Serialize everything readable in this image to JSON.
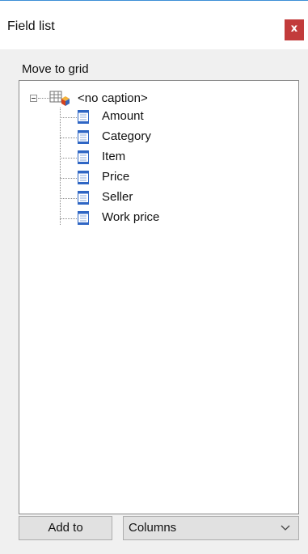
{
  "window": {
    "title": "Field list",
    "close_label": "x"
  },
  "group": {
    "label": "Move to grid"
  },
  "tree": {
    "root": {
      "label": "<no caption>",
      "icon": "cube-icon"
    },
    "items": [
      {
        "label": "Amount",
        "icon": "field-icon"
      },
      {
        "label": "Category",
        "icon": "field-icon"
      },
      {
        "label": "Item",
        "icon": "field-icon"
      },
      {
        "label": "Price",
        "icon": "field-icon"
      },
      {
        "label": "Seller",
        "icon": "field-icon"
      },
      {
        "label": "Work price",
        "icon": "field-icon"
      }
    ]
  },
  "footer": {
    "add_label": "Add to",
    "target": {
      "selected": "Columns"
    }
  },
  "colors": {
    "close_button": "#c23b3b",
    "window_border": "#3c8fd6",
    "panel_background": "#f0f0f0",
    "tree_background": "#ffffff"
  }
}
